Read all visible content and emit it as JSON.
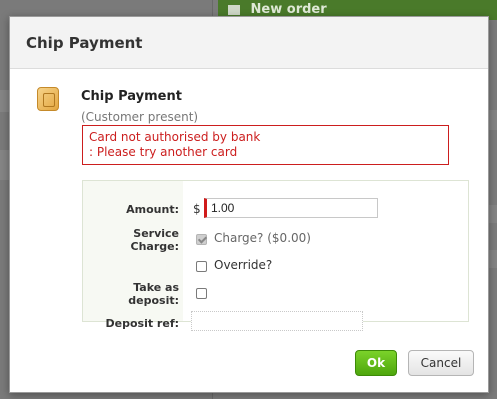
{
  "background": {
    "new_order_label": "New order"
  },
  "modal": {
    "title": "Chip Payment",
    "payment_title": "Chip Payment",
    "subtitle": "(Customer present)",
    "error_lines": [
      "Card not authorised by bank",
      ": Please try another card"
    ]
  },
  "form": {
    "amount_label": "Amount:",
    "currency_symbol": "$",
    "amount_value": "1.00",
    "service_label_line1": "Service",
    "service_label_line2": "Charge:",
    "charge_label": "Charge? ($0.00)",
    "charge_checked": true,
    "override_label": "Override?",
    "override_checked": false,
    "take_deposit_line1": "Take as",
    "take_deposit_line2": "deposit:",
    "take_deposit_checked": false,
    "deposit_ref_label": "Deposit ref:",
    "deposit_ref_value": ""
  },
  "buttons": {
    "ok": "Ok",
    "cancel": "Cancel"
  },
  "colors": {
    "error": "#cc1e1e",
    "ok_button": "#5cb516",
    "header_green": "#4a7a2a"
  }
}
